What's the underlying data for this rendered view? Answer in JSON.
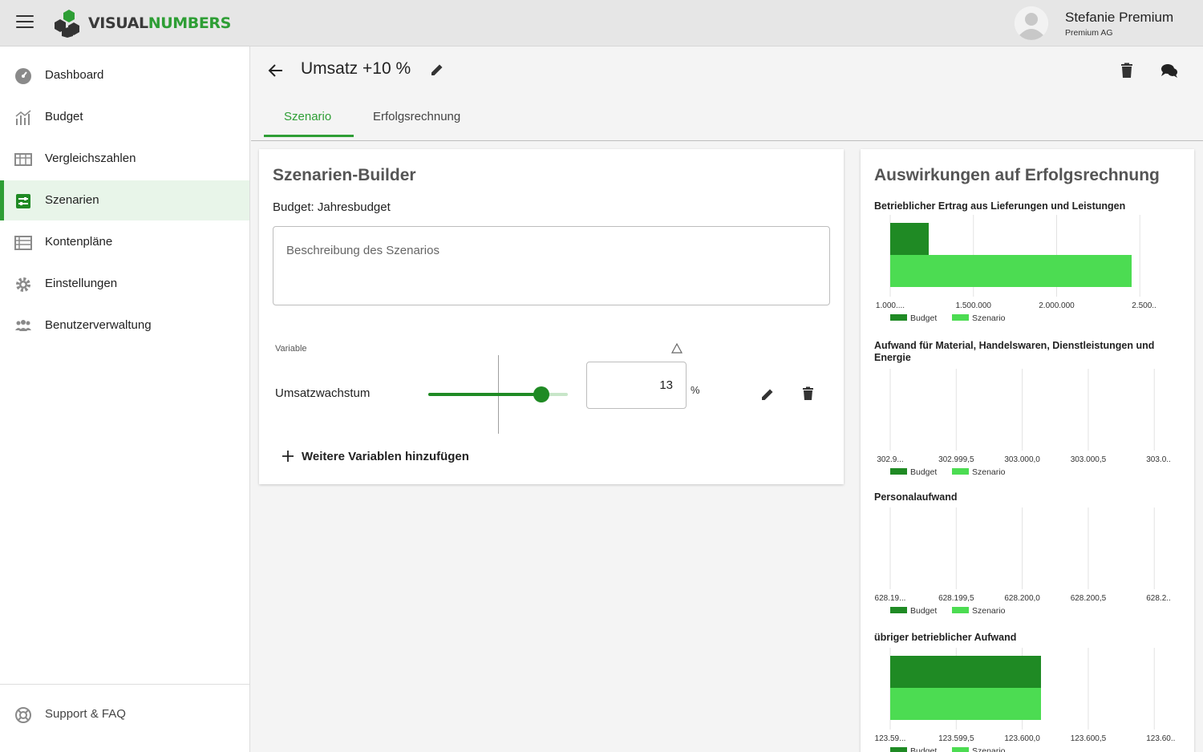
{
  "app": {
    "logo_part1": "VISUAL",
    "logo_part2": "NUMBERS",
    "user_name": "Stefanie Premium",
    "user_company": "Premium AG",
    "accent_color": "#2e9e35"
  },
  "sidebar": {
    "items": [
      {
        "label": "Dashboard",
        "icon": "dashboard-gauge-icon",
        "active": false
      },
      {
        "label": "Budget",
        "icon": "bar-chart-icon",
        "active": false
      },
      {
        "label": "Vergleichszahlen",
        "icon": "table-icon",
        "active": false
      },
      {
        "label": "Szenarien",
        "icon": "scenario-sliders-icon",
        "active": true
      },
      {
        "label": "Kontenpläne",
        "icon": "list-icon",
        "active": false
      },
      {
        "label": "Einstellungen",
        "icon": "gear-icon",
        "active": false
      },
      {
        "label": "Benutzerverwaltung",
        "icon": "users-icon",
        "active": false
      }
    ],
    "support_label": "Support & FAQ"
  },
  "header": {
    "title": "Umsatz +10 %",
    "tabs": [
      {
        "label": "Szenario",
        "active": true
      },
      {
        "label": "Erfolgsrechnung",
        "active": false
      }
    ]
  },
  "builder": {
    "title": "Szenarien-Builder",
    "budget_label": "Budget: Jahresbudget",
    "description_placeholder": "Beschreibung des Szenarios",
    "variable_header": "Variable",
    "variables": [
      {
        "name": "Umsatzwachstum",
        "value": "13",
        "unit": "%",
        "slider_fraction": 0.81
      }
    ],
    "add_variable_label": "Weitere Variablen hinzufügen"
  },
  "impact": {
    "title": "Auswirkungen auf Erfolgsrechnung",
    "legend_budget": "Budget",
    "legend_szenario": "Szenario",
    "colors": {
      "budget": "#1f8a24",
      "szenario": "#4cdc52"
    }
  },
  "chart_data": [
    {
      "type": "bar",
      "orientation": "horizontal",
      "title": "Betrieblicher Ertrag aus Lieferungen und Leistungen",
      "categories": [
        "Budget",
        "Szenario"
      ],
      "values": [
        1190000,
        2400000
      ],
      "xlim": [
        1000000,
        2600000
      ],
      "tick_labels": [
        "1.000....",
        "1.500.000",
        "2.000.000",
        "2.500.."
      ],
      "grid": true,
      "legend_position": "bottom"
    },
    {
      "type": "bar",
      "orientation": "horizontal",
      "title": "Aufwand für Material, Handelswaren, Dienstleistungen und Energie",
      "categories": [
        "Budget",
        "Szenario"
      ],
      "values": [
        302999,
        302999
      ],
      "xlim": [
        302999,
        303001
      ],
      "tick_labels": [
        "302.9...",
        "302.999,5",
        "303.000,0",
        "303.000,5",
        "303.0.."
      ],
      "grid": true,
      "legend_position": "bottom"
    },
    {
      "type": "bar",
      "orientation": "horizontal",
      "title": "Personalaufwand",
      "categories": [
        "Budget",
        "Szenario"
      ],
      "values": [
        628199,
        628199
      ],
      "xlim": [
        628199,
        628201
      ],
      "tick_labels": [
        "628.19...",
        "628.199,5",
        "628.200,0",
        "628.200,5",
        "628.2.."
      ],
      "grid": true,
      "legend_position": "bottom"
    },
    {
      "type": "bar",
      "orientation": "horizontal",
      "title": "übriger betrieblicher Aufwand",
      "categories": [
        "Budget",
        "Szenario"
      ],
      "values": [
        123600,
        123600
      ],
      "xlim": [
        123599,
        123601
      ],
      "tick_labels": [
        "123.59...",
        "123.599,5",
        "123.600,0",
        "123.600,5",
        "123.60.."
      ],
      "grid": true,
      "legend_position": "bottom"
    }
  ]
}
